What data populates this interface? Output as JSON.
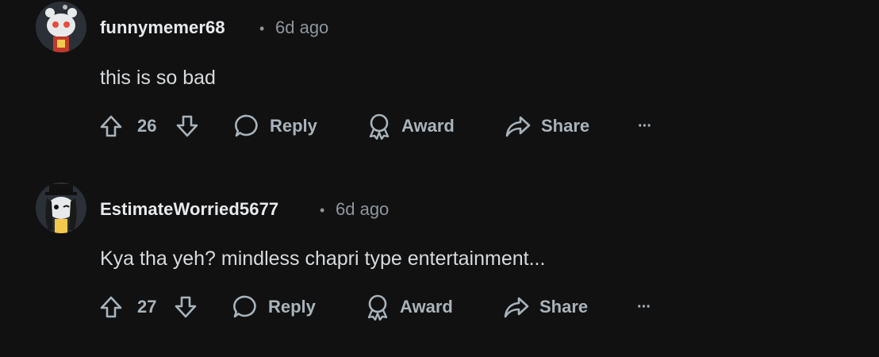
{
  "comments": [
    {
      "username": "funnymemer68",
      "separator": "•",
      "time": "6d ago",
      "body": "this is so bad",
      "votes": "26",
      "reply_label": "Reply",
      "award_label": "Award",
      "share_label": "Share",
      "more_label": "···",
      "avatar_bg": "#e7e9ea",
      "avatar_accent": "#c0392b"
    },
    {
      "username": "EstimateWorried5677",
      "separator": "•",
      "time": "6d ago",
      "body": "Kya tha yeh? mindless chapri type entertainment...",
      "votes": "27",
      "reply_label": "Reply",
      "award_label": "Award",
      "share_label": "Share",
      "more_label": "···",
      "avatar_bg": "#1a1a1a",
      "avatar_accent": "#f2c94c"
    }
  ],
  "colors": {
    "background": "#111112",
    "username": "#e8eaed",
    "meta": "#8e969c",
    "action": "#a9b3ba"
  }
}
